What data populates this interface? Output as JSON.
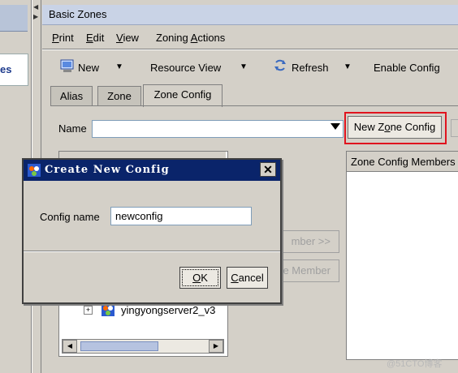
{
  "left": {
    "partial_item": "es"
  },
  "window": {
    "title": "Basic Zones"
  },
  "menu": {
    "items": [
      {
        "label": "Print",
        "u": "P"
      },
      {
        "label": "Edit",
        "u": "E"
      },
      {
        "label": "View",
        "u": "V"
      },
      {
        "label": "Zoning Actions",
        "u": "A"
      }
    ]
  },
  "toolbar": {
    "new_label": "New",
    "resource_view_label": "Resource View",
    "refresh_label": "Refresh",
    "enable_config_label": "Enable Config"
  },
  "tabs": [
    "Alias",
    "Zone",
    "Zone Config"
  ],
  "active_tab": "Zone Config",
  "name_field": {
    "label": "Name",
    "value": ""
  },
  "new_zone_config_button": "New Zone Config",
  "members_panel": {
    "title": "Zone Config Members"
  },
  "middle_buttons": {
    "add_member": "mber >>",
    "remove_member": "ve Member"
  },
  "tree": {
    "node_label": "yingyongserver2_v3"
  },
  "dialog": {
    "title": "Create New Config",
    "config_name_label": "Config name",
    "config_name_value": "newconfig",
    "ok_label": "OK",
    "cancel_label": "Cancel"
  },
  "watermark": "@51CTO博客",
  "colors": {
    "dialog_title_bg": "#0a246a",
    "highlight": "#e0141e"
  }
}
